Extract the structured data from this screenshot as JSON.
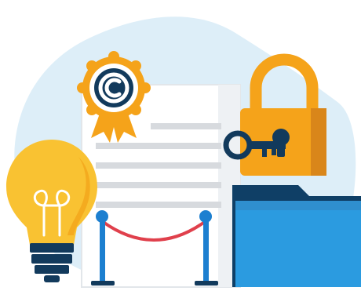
{
  "illustration": {
    "subject": "intellectual-property-protection",
    "icons": [
      "copyright-seal-icon",
      "document-icon",
      "padlock-icon",
      "key-icon",
      "folder-icon",
      "lightbulb-icon",
      "rope-barrier-icon"
    ],
    "seal_symbol": "©"
  },
  "colors": {
    "background_blob": "#ddeef8",
    "navy": "#123a5c",
    "orange": "#f5a31a",
    "orange_dark": "#d9861a",
    "bulb_yellow": "#f9c232",
    "folder_blue": "#2b9be0",
    "folder_dark": "#0f3f66",
    "doc_lines": "#d7dade",
    "rope_red": "#e0404c",
    "stanchion_blue": "#1c7fd0"
  }
}
